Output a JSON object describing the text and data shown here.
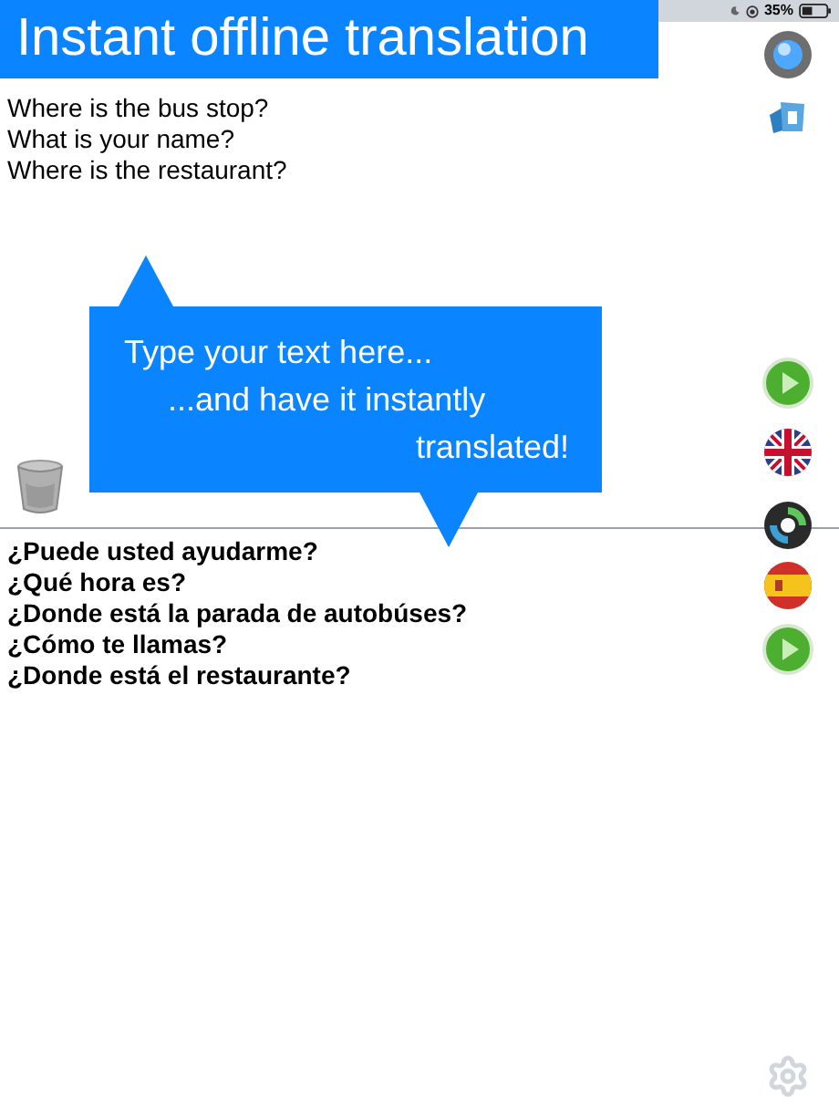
{
  "status_bar": {
    "battery": "35%"
  },
  "banner": {
    "title": "Instant offline translation"
  },
  "source": {
    "lines": [
      "Where is the bus stop?",
      "What is your name?",
      "Where is the restaurant?"
    ]
  },
  "callout": {
    "lines": [
      "Type your text here...",
      "...and have it instantly",
      "translated!"
    ]
  },
  "translation": {
    "lines": [
      "¿Puede usted ayudarme?",
      "¿Qué hora es?",
      "¿Donde está la parada de autobúses?",
      "¿Cómo te llamas?",
      "¿Donde está el restaurante?"
    ]
  }
}
